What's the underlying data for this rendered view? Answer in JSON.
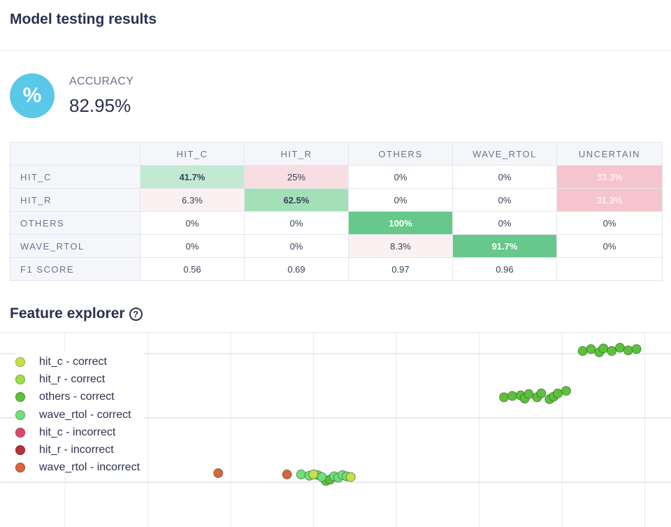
{
  "header": {
    "title": "Model testing results"
  },
  "accuracy": {
    "icon": "percent-icon",
    "icon_glyph": "%",
    "label": "ACCURACY",
    "value": "82.95%"
  },
  "confusion_matrix": {
    "columns": [
      "HIT_C",
      "HIT_R",
      "OTHERS",
      "WAVE_RTOL",
      "UNCERTAIN"
    ],
    "rows": [
      {
        "label": "HIT_C",
        "cells": [
          "41.7%",
          "25%",
          "0%",
          "0%",
          "33.3%"
        ]
      },
      {
        "label": "HIT_R",
        "cells": [
          "6.3%",
          "62.5%",
          "0%",
          "0%",
          "31.3%"
        ]
      },
      {
        "label": "OTHERS",
        "cells": [
          "0%",
          "0%",
          "100%",
          "0%",
          "0%"
        ]
      },
      {
        "label": "WAVE_RTOL",
        "cells": [
          "0%",
          "0%",
          "8.3%",
          "91.7%",
          "0%"
        ]
      },
      {
        "label": "F1 SCORE",
        "cells": [
          "0.56",
          "0.69",
          "0.97",
          "0.96",
          ""
        ]
      }
    ]
  },
  "feature_explorer": {
    "title": "Feature explorer",
    "help_icon": "help-circle-icon",
    "help_glyph": "?",
    "legend": [
      {
        "label": "hit_c - correct",
        "color": "#c5e04a"
      },
      {
        "label": "hit_r - correct",
        "color": "#9be04a"
      },
      {
        "label": "others - correct",
        "color": "#5cc23c"
      },
      {
        "label": "wave_rtol - correct",
        "color": "#6ee07a"
      },
      {
        "label": "hit_c - incorrect",
        "color": "#d94a6e"
      },
      {
        "label": "hit_r - incorrect",
        "color": "#b8303a"
      },
      {
        "label": "wave_rtol - incorrect",
        "color": "#d9653e"
      }
    ]
  },
  "chart_data": {
    "type": "scatter",
    "title": "",
    "xlabel": "",
    "ylabel": "",
    "grid": true,
    "legend_position": "top-left",
    "xlim": [
      0,
      8
    ],
    "ylim": [
      0,
      2.7
    ],
    "series": [
      {
        "name": "others - correct",
        "points": [
          [
            5.3,
            1.3
          ],
          [
            5.4,
            1.32
          ],
          [
            5.5,
            1.33
          ],
          [
            5.55,
            1.28
          ],
          [
            5.6,
            1.35
          ],
          [
            5.7,
            1.3
          ],
          [
            5.75,
            1.36
          ],
          [
            5.85,
            1.27
          ],
          [
            5.9,
            1.31
          ],
          [
            5.95,
            1.36
          ],
          [
            6.05,
            1.4
          ],
          [
            6.25,
            2.02
          ],
          [
            6.35,
            2.05
          ],
          [
            6.45,
            2.0
          ],
          [
            6.5,
            2.06
          ],
          [
            6.6,
            2.02
          ],
          [
            6.7,
            2.07
          ],
          [
            6.8,
            2.03
          ],
          [
            6.9,
            2.05
          ],
          [
            3.15,
            0.0
          ],
          [
            3.2,
            0.02
          ]
        ]
      },
      {
        "name": "wave_rtol - correct",
        "points": [
          [
            2.85,
            0.1
          ],
          [
            2.95,
            0.08
          ],
          [
            3.05,
            0.09
          ],
          [
            3.1,
            0.06
          ],
          [
            3.25,
            0.07
          ],
          [
            3.3,
            0.05
          ],
          [
            3.35,
            0.09
          ],
          [
            3.4,
            0.07
          ]
        ]
      },
      {
        "name": "hit_c - correct",
        "points": [
          [
            3.0,
            0.1
          ],
          [
            3.45,
            0.06
          ]
        ]
      },
      {
        "name": "wave_rtol - incorrect",
        "points": [
          [
            1.85,
            0.12
          ],
          [
            2.68,
            0.1
          ]
        ]
      }
    ]
  }
}
